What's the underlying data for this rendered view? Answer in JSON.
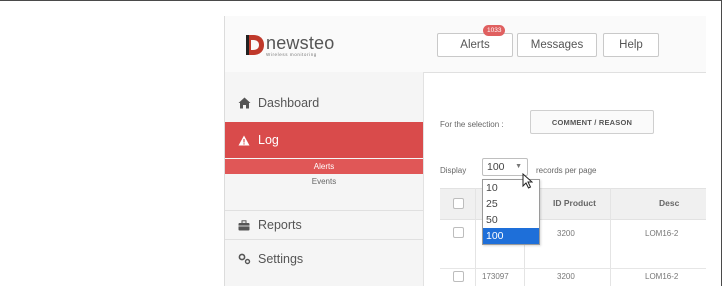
{
  "header": {
    "logo_word": "newsteo",
    "logo_tagline": "Wireless monitoring",
    "buttons": [
      {
        "label": "Alerts",
        "badge": "1033"
      },
      {
        "label": "Messages"
      },
      {
        "label": "Help"
      }
    ]
  },
  "sidebar": {
    "items": [
      {
        "label": "Dashboard",
        "icon": "home-icon"
      },
      {
        "label": "Log",
        "icon": "warning-icon",
        "active": true
      },
      {
        "label": "Reports",
        "icon": "briefcase-icon"
      },
      {
        "label": "Settings",
        "icon": "gears-icon"
      }
    ],
    "log_sub": [
      {
        "label": "Alerts",
        "active": true
      },
      {
        "label": "Events"
      }
    ]
  },
  "content": {
    "selection_label": "For the selection :",
    "selection_button": "COMMENT / REASON",
    "display_label": "Display",
    "display_value": "100",
    "records_label": "records per page",
    "dropdown_options": [
      "10",
      "25",
      "50",
      "100"
    ],
    "dropdown_selected": "100",
    "table": {
      "headers": [
        "ID Product",
        "Desc"
      ],
      "rows": [
        {
          "id": "",
          "product": "3200",
          "desc": "LOM16-2"
        },
        {
          "id": "173097",
          "product": "3200",
          "desc": "LOM16-2"
        }
      ]
    }
  },
  "colors": {
    "accent_red": "#d94b4b",
    "sub_active": "#e05757",
    "dropdown_selected": "#1e6fd9",
    "badge": "#e06060"
  }
}
